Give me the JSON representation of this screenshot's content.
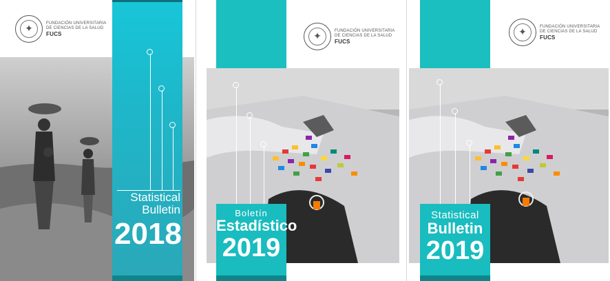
{
  "logo": {
    "line1": "FUNDACIÓN UNIVERSITARIA",
    "line2": "DE CIENCIAS DE LA SALUD",
    "acronym": "FUCS"
  },
  "covers": [
    {
      "title_line1": "Statistical",
      "title_line2": "Bulletin",
      "year": "2018"
    },
    {
      "title_line1": "Boletín",
      "title_line2": "Estadístico",
      "year": "2019"
    },
    {
      "title_line1": "Statistical",
      "title_line2": "Bulletin",
      "year": "2019"
    }
  ],
  "colors": {
    "teal": "#1bbfc0",
    "dark_teal": "#0f8589"
  }
}
